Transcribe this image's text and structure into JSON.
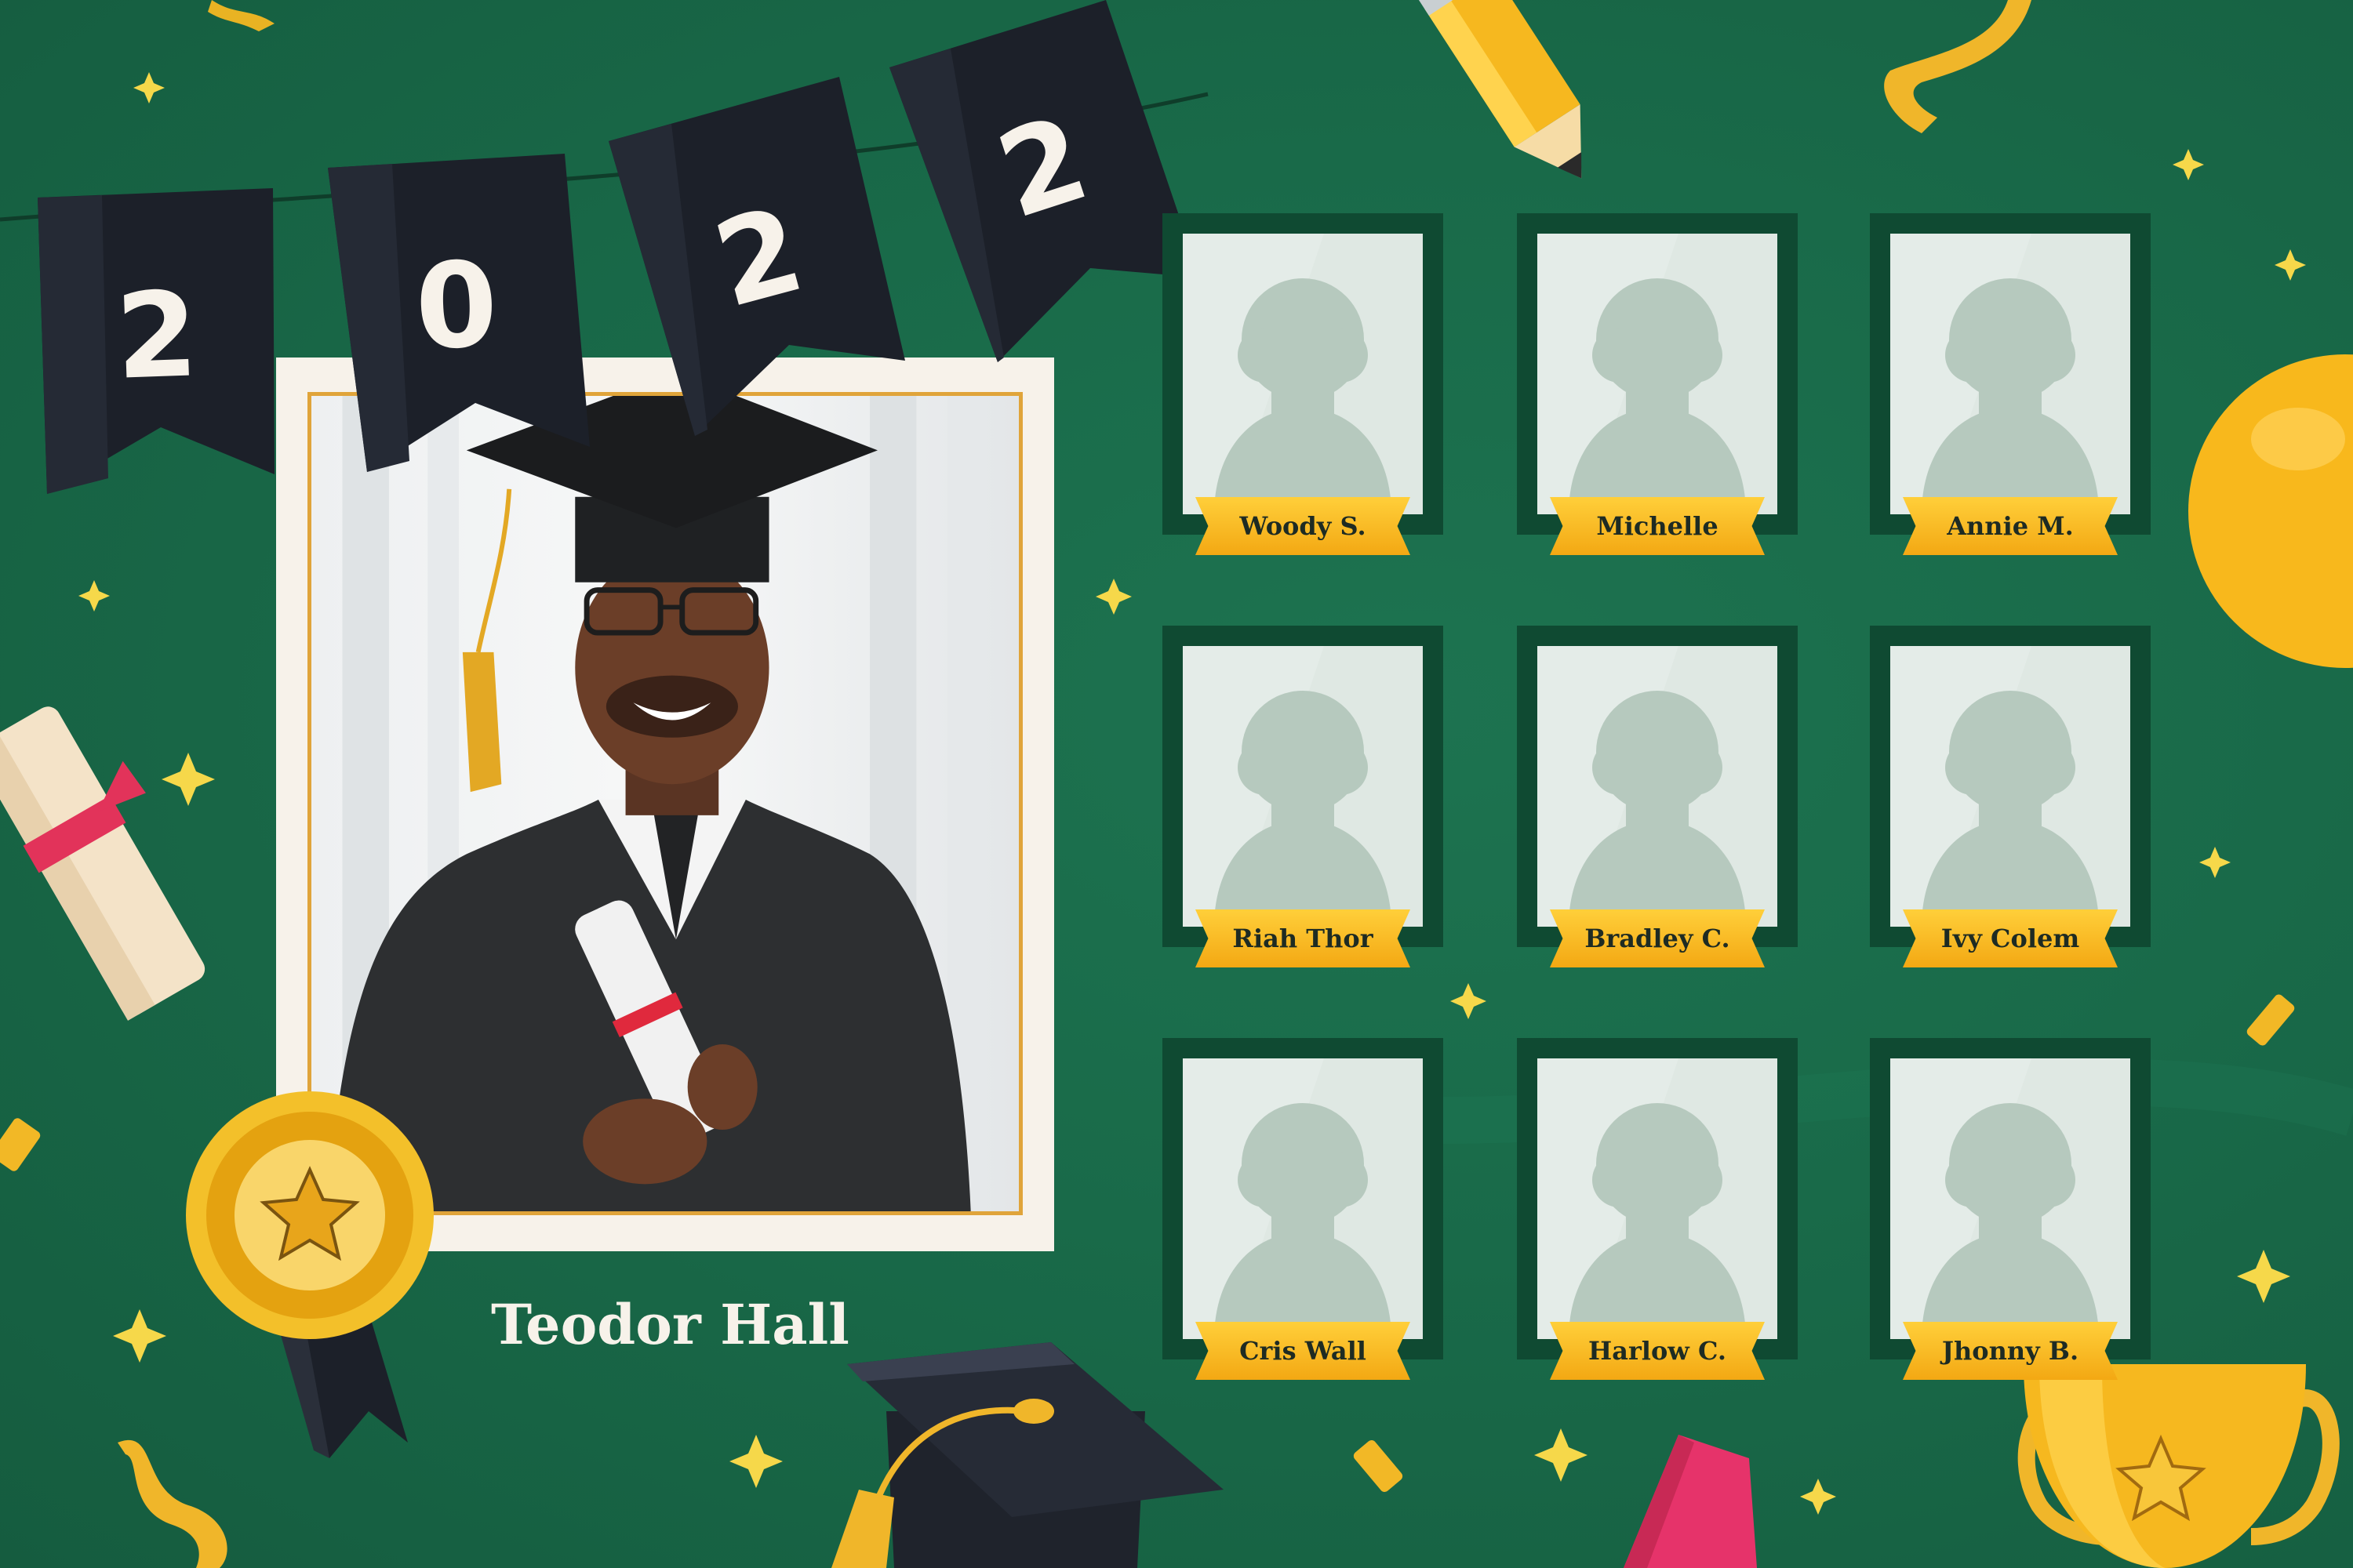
{
  "banner": {
    "digits": [
      "2",
      "0",
      "2",
      "2"
    ]
  },
  "featured": {
    "name": "Teodor Hall"
  },
  "students": [
    {
      "name": "Woody S."
    },
    {
      "name": "Michelle"
    },
    {
      "name": "Annie M."
    },
    {
      "name": "Riah Thor"
    },
    {
      "name": "Bradley C."
    },
    {
      "name": "Ivy Colem"
    },
    {
      "name": "Cris Wall"
    },
    {
      "name": "Harlow C."
    },
    {
      "name": "Jhonny B."
    }
  ],
  "icons": [
    "sparkle-icon",
    "pencil-icon",
    "balloon-icon",
    "diploma-icon",
    "medal-icon",
    "graduation-cap-icon",
    "trophy-icon",
    "streamer-icon",
    "confetti-icon",
    "book-icon"
  ],
  "colors": {
    "background": "#1b6b4b",
    "card_frame": "#0f4a32",
    "banner": "#1c2029",
    "gold": "#f6b41c",
    "frame": "#f7f2ea"
  }
}
